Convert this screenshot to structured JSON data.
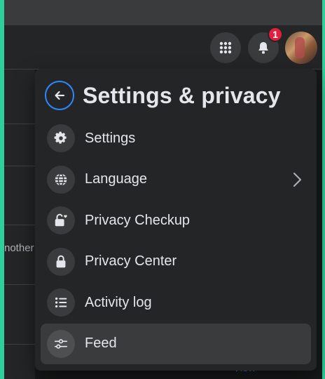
{
  "topbar": {
    "menu_icon": "grid-icon",
    "notifications_icon": "bell-icon",
    "notification_count": "1",
    "avatar": "avatar"
  },
  "background": {
    "peek_text": "nother",
    "view_link": "View"
  },
  "panel": {
    "title": "Settings & privacy",
    "back_icon": "arrow-left-icon",
    "items": [
      {
        "label": "Settings",
        "icon": "gear-icon"
      },
      {
        "label": "Language",
        "icon": "globe-icon",
        "chevron": "chevron-right-icon"
      },
      {
        "label": "Privacy Checkup",
        "icon": "lock-heart-icon"
      },
      {
        "label": "Privacy Center",
        "icon": "lock-icon"
      },
      {
        "label": "Activity log",
        "icon": "list-icon"
      },
      {
        "label": "Feed",
        "icon": "sliders-icon"
      }
    ],
    "colors": {
      "accent": "#2d88ff",
      "surface": "#242526",
      "badge": "#e41e3f"
    }
  }
}
